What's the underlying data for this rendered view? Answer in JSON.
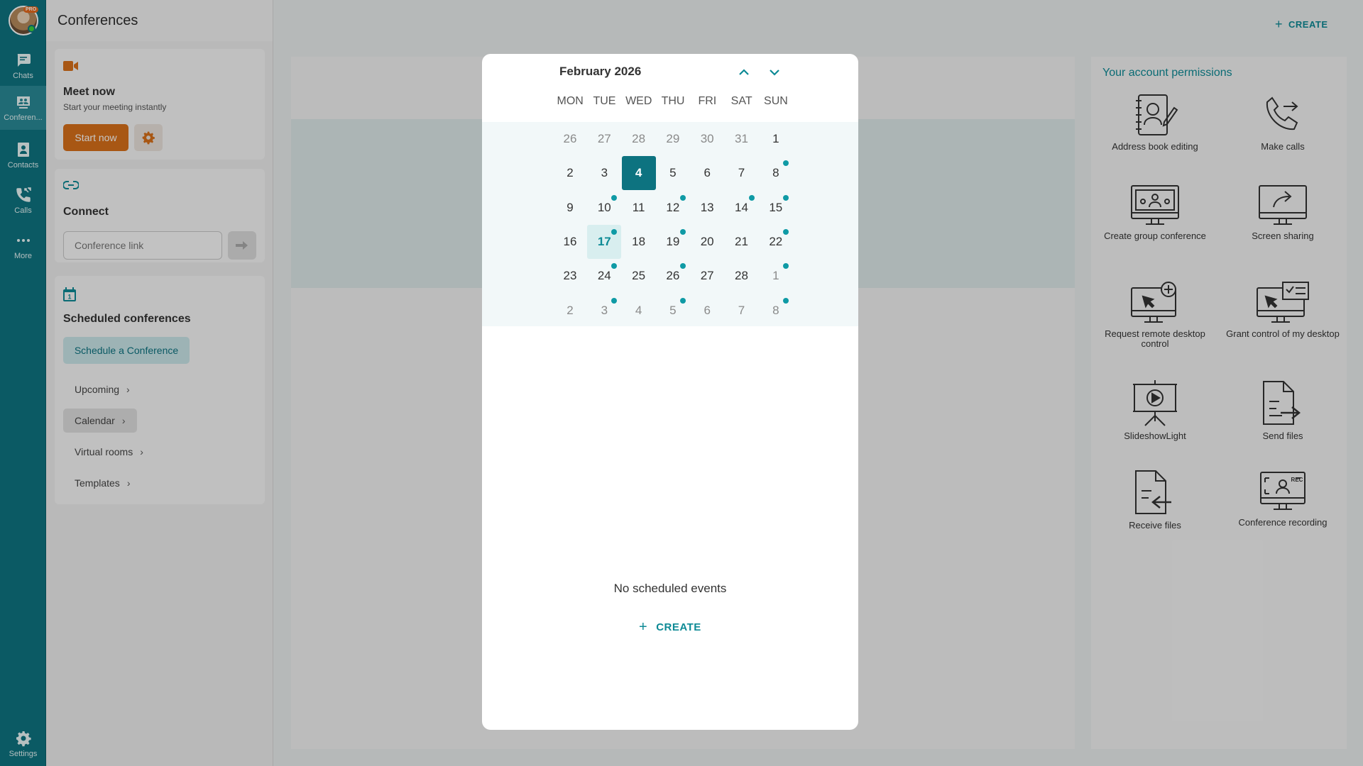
{
  "rail": {
    "pro_badge": "PRO",
    "items": [
      {
        "label": "Chats",
        "icon": "chat-icon"
      },
      {
        "label": "Conferen...",
        "icon": "conference-icon"
      },
      {
        "label": "Contacts",
        "icon": "contacts-icon"
      },
      {
        "label": "Calls",
        "icon": "calls-icon"
      },
      {
        "label": "More",
        "icon": "more-icon"
      }
    ],
    "settings_label": "Settings"
  },
  "panel": {
    "title": "Conferences",
    "meet_now": {
      "title": "Meet now",
      "subtitle": "Start your meeting instantly",
      "start_label": "Start now"
    },
    "connect": {
      "title": "Connect",
      "placeholder": "Conference link"
    },
    "scheduled": {
      "title": "Scheduled conferences",
      "calendar_icon_day": "1",
      "schedule_label": "Schedule a Conference",
      "links": [
        "Upcoming",
        "Calendar",
        "Virtual rooms",
        "Templates"
      ],
      "active_link": "Calendar"
    }
  },
  "main": {
    "create_label": "CREATE"
  },
  "permissions": {
    "title": "Your account permissions",
    "items": [
      "Address book editing",
      "Make calls",
      "Create group conference",
      "Screen sharing",
      "Request remote desktop control",
      "Grant control of my desktop",
      "SlideshowLight",
      "Send files",
      "Receive files",
      "Conference recording"
    ],
    "rec_badge": "REC"
  },
  "calendar": {
    "month_title": "February 2026",
    "weekdays": [
      "MON",
      "TUE",
      "WED",
      "THU",
      "FRI",
      "SAT",
      "SUN"
    ],
    "weeks": [
      [
        {
          "d": "26",
          "m": true
        },
        {
          "d": "27",
          "m": true
        },
        {
          "d": "28",
          "m": true
        },
        {
          "d": "29",
          "m": true
        },
        {
          "d": "30",
          "m": true
        },
        {
          "d": "31",
          "m": true
        },
        {
          "d": "1"
        }
      ],
      [
        {
          "d": "2"
        },
        {
          "d": "3"
        },
        {
          "d": "4",
          "today": true
        },
        {
          "d": "5"
        },
        {
          "d": "6"
        },
        {
          "d": "7"
        },
        {
          "d": "8",
          "dot": true
        }
      ],
      [
        {
          "d": "9"
        },
        {
          "d": "10",
          "dot": true
        },
        {
          "d": "11"
        },
        {
          "d": "12",
          "dot": true
        },
        {
          "d": "13"
        },
        {
          "d": "14",
          "dot": true
        },
        {
          "d": "15",
          "dot": true
        }
      ],
      [
        {
          "d": "16"
        },
        {
          "d": "17",
          "selected": true,
          "dot": true
        },
        {
          "d": "18"
        },
        {
          "d": "19",
          "dot": true
        },
        {
          "d": "20"
        },
        {
          "d": "21"
        },
        {
          "d": "22",
          "dot": true
        }
      ],
      [
        {
          "d": "23"
        },
        {
          "d": "24",
          "dot": true
        },
        {
          "d": "25"
        },
        {
          "d": "26",
          "dot": true
        },
        {
          "d": "27"
        },
        {
          "d": "28"
        },
        {
          "d": "1",
          "m": true,
          "dot": true
        }
      ],
      [
        {
          "d": "2",
          "m": true
        },
        {
          "d": "3",
          "m": true,
          "dot": true
        },
        {
          "d": "4",
          "m": true
        },
        {
          "d": "5",
          "m": true,
          "dot": true
        },
        {
          "d": "6",
          "m": true
        },
        {
          "d": "7",
          "m": true
        },
        {
          "d": "8",
          "m": true,
          "dot": true
        }
      ]
    ],
    "empty_text": "No scheduled events",
    "create_label": "CREATE"
  },
  "colors": {
    "rail": "#0f7481",
    "accent": "#0d8a95",
    "today": "#0d7380",
    "orange": "#d8701a",
    "event_dot": "#0f9aa5"
  }
}
